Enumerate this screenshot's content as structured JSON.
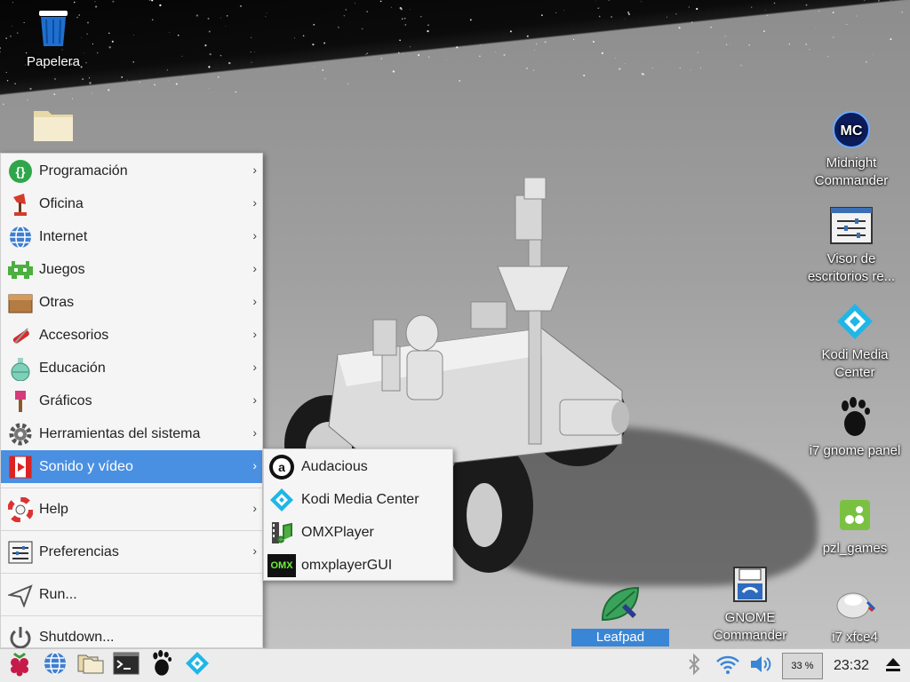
{
  "desktop": {
    "icons": [
      {
        "name": "trash",
        "label": "Papelera"
      },
      {
        "name": "folder",
        "label": ""
      },
      {
        "name": "midnight-commander",
        "label": "Midnight Commander"
      },
      {
        "name": "visor-escritorios",
        "label": "Visor de escritorios re..."
      },
      {
        "name": "kodi",
        "label": "Kodi Media Center"
      },
      {
        "name": "i7-gnome-panel",
        "label": "i7 gnome panel"
      },
      {
        "name": "pzl-games",
        "label": "pzl_games"
      },
      {
        "name": "leafpad",
        "label": "Leafpad"
      },
      {
        "name": "gnome-commander",
        "label": "GNOME Commander"
      },
      {
        "name": "i7-xfce4",
        "label": "i7 xfce4"
      }
    ]
  },
  "menu": {
    "items": [
      {
        "label": "Programación",
        "icon": "programming-icon"
      },
      {
        "label": "Oficina",
        "icon": "office-icon"
      },
      {
        "label": "Internet",
        "icon": "globe-icon"
      },
      {
        "label": "Juegos",
        "icon": "games-icon"
      },
      {
        "label": "Otras",
        "icon": "box-icon"
      },
      {
        "label": "Accesorios",
        "icon": "accessories-icon"
      },
      {
        "label": "Educación",
        "icon": "flask-icon"
      },
      {
        "label": "Gráficos",
        "icon": "paintbrush-icon"
      },
      {
        "label": "Herramientas del sistema",
        "icon": "gear-icon"
      },
      {
        "label": "Sonido y vídeo",
        "icon": "film-icon"
      },
      {
        "label": "Help",
        "icon": "lifebuoy-icon"
      },
      {
        "label": "Preferencias",
        "icon": "preferences-icon"
      },
      {
        "label": "Run...",
        "icon": "run-icon"
      },
      {
        "label": "Shutdown...",
        "icon": "power-icon"
      }
    ],
    "active": "Sonido y vídeo"
  },
  "submenu": {
    "items": [
      {
        "label": "Audacious",
        "icon": "audacious-icon"
      },
      {
        "label": "Kodi Media Center",
        "icon": "kodi-icon"
      },
      {
        "label": "OMXPlayer",
        "icon": "omxplayer-icon"
      },
      {
        "label": "omxplayerGUI",
        "icon": "omx-icon",
        "badge": "OMX"
      }
    ]
  },
  "taskbar": {
    "cpu": "33 %",
    "clock": "23:32"
  },
  "colors": {
    "menu_highlight": "#4a90e2",
    "selected_label": "#3a86d6"
  }
}
